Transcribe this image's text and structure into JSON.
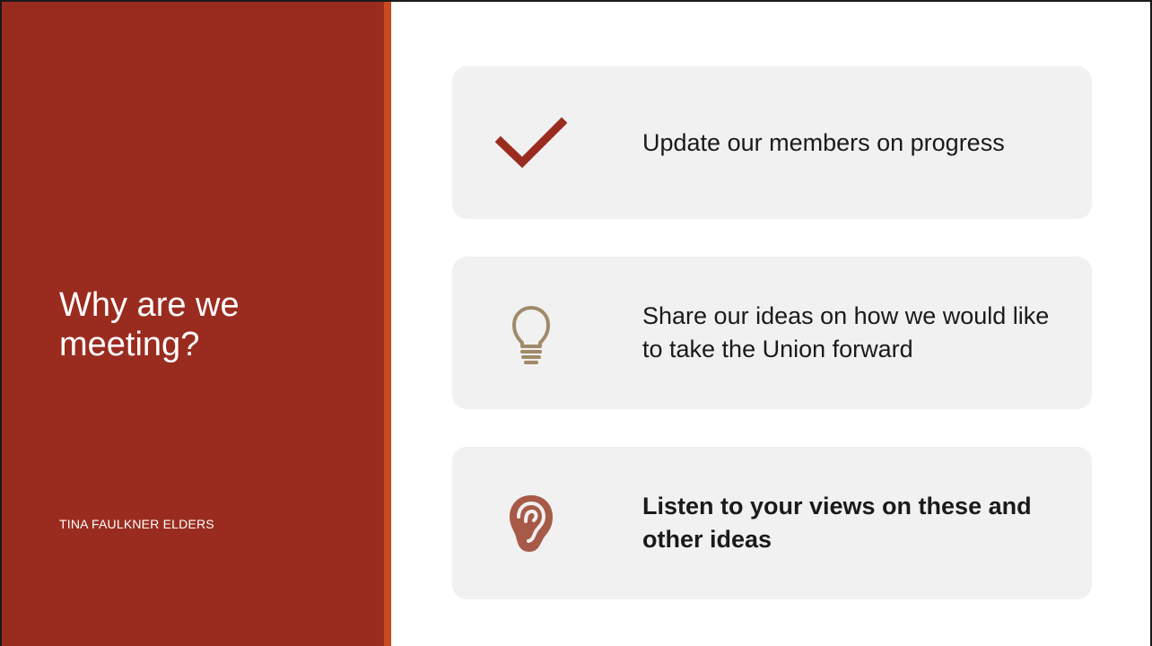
{
  "slide": {
    "title": "Why are we\nmeeting?",
    "subtitle": "TINA FAULKNER ELDERS",
    "colors": {
      "left_panel": "#9a2c1f",
      "accent_bar": "#cc4a1f",
      "card_background": "#f1f1f1",
      "checkmark": "#9a2c1f",
      "lightbulb": "#a08a6a",
      "ear": "#a85a48"
    }
  },
  "items": [
    {
      "icon": "checkmark-icon",
      "text": "Update our members on progress",
      "bold": false
    },
    {
      "icon": "lightbulb-icon",
      "text": "Share our ideas on how we would like to take the Union forward",
      "bold": false
    },
    {
      "icon": "ear-icon",
      "text": "Listen to your views on these and other ideas",
      "bold": true
    }
  ]
}
